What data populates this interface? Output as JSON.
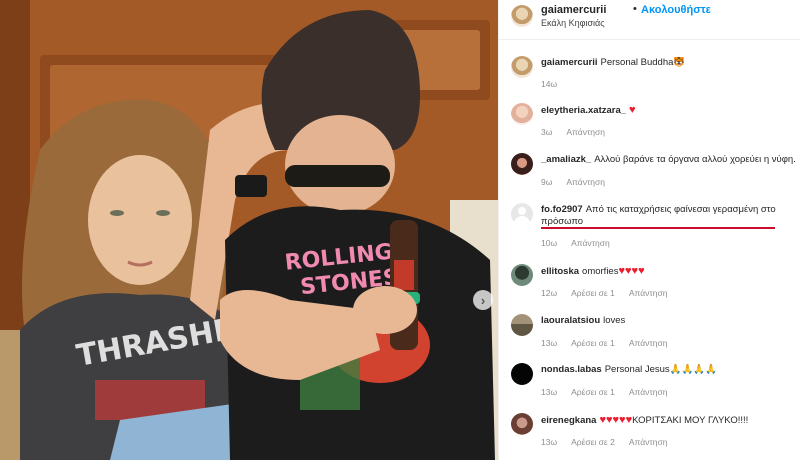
{
  "post": {
    "username": "gaiamercurii",
    "dot": "•",
    "follow_label": "Ακολουθήστε",
    "location": "Εκάλη Κηφισιάς",
    "caption": "Personal Buddha",
    "caption_emoji": "🐯",
    "caption_time": "14ω"
  },
  "labels": {
    "reply": "Απάντηση",
    "like_one": "Αρέσει σε 1",
    "like_two": "Αρέσει σε 2"
  },
  "comments": [
    {
      "user": "eleytheria.xatzara_",
      "text": "",
      "hearts": "♥",
      "time": "3ω"
    },
    {
      "user": "_amaliazk_",
      "text": "Αλλού βαράνε τα όργανα αλλού χορεύει η νύφη...",
      "time": "9ω"
    },
    {
      "user": "fo.fo2907",
      "text": "Από τις καταχρήσεις φαίνεσαι γερασμένη στο πρόσωπο",
      "time": "10ω"
    },
    {
      "user": "ellitoska",
      "text": "omorfies",
      "hearts": "♥♥♥♥",
      "time": "12ω"
    },
    {
      "user": "laouralatsiou",
      "text": "loves",
      "time": "13ω"
    },
    {
      "user": "nondas.labas",
      "text": "Personal Jesus🙏🙏🙏🙏",
      "time": "13ω"
    },
    {
      "user": "eirenegkana",
      "text": "ΚΟΡΙΤΣΑΚΙ ΜΟΥ ΓΛΥΚΟ!!!!",
      "hearts": "♥♥♥♥♥",
      "time": "13ω"
    }
  ],
  "photo": {
    "shirt_left": "THRASHER",
    "shirt_right_1": "ROLLING",
    "shirt_right_2": "STONES"
  },
  "icons": {
    "next": "chevron-right-icon",
    "default_avatar": "default-avatar-icon"
  },
  "colors": {
    "accent": "#0095f6",
    "heart": "#ed1c2e",
    "underline": "#c8102e"
  }
}
